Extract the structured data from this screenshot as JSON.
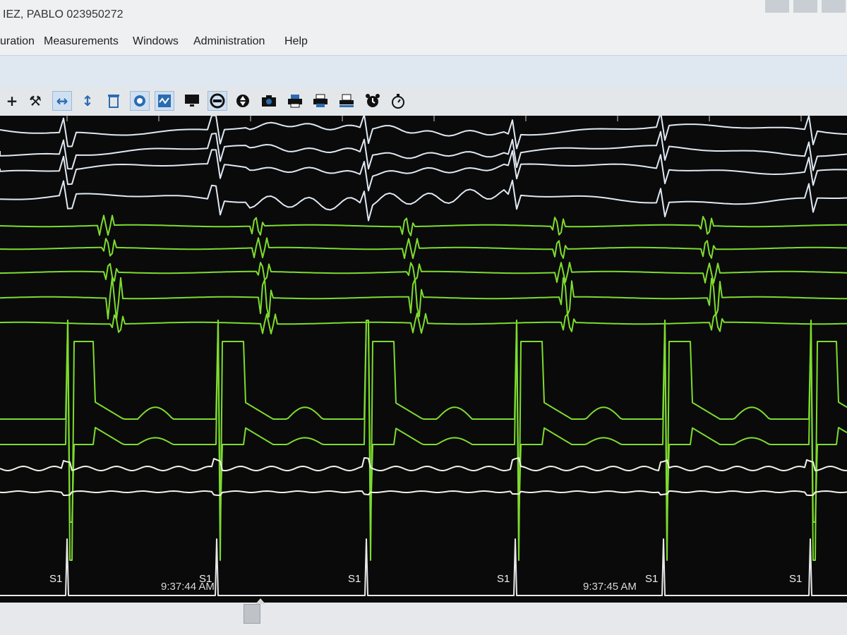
{
  "window": {
    "title": "IEZ, PABLO 023950272"
  },
  "menu": {
    "items": [
      "uration",
      "Measurements",
      "Windows",
      "Administration",
      "Help"
    ]
  },
  "toolbar": {
    "icons": [
      "plus-icon",
      "tools-icon",
      "expand-horizontal-icon",
      "expand-vertical-icon",
      "trash-icon",
      "toggle-icon",
      "waveform-icon",
      "monitor-icon",
      "refresh-icon",
      "up-down-icon",
      "camera-icon",
      "printer-icon",
      "printer-alt-icon",
      "print-preview-icon",
      "alarm-clock-icon",
      "stopwatch-icon"
    ]
  },
  "tracing": {
    "timestamps": [
      "9:37:44 AM",
      "9:37:45 AM"
    ],
    "stim_marker": "S1",
    "stim_count": 6,
    "colors": {
      "background": "#0a0a0a",
      "surface_channels": "#dfe8f3",
      "intracardiac_channels": "#7ddc2e",
      "reference_channels": "#f2f2ea"
    }
  }
}
